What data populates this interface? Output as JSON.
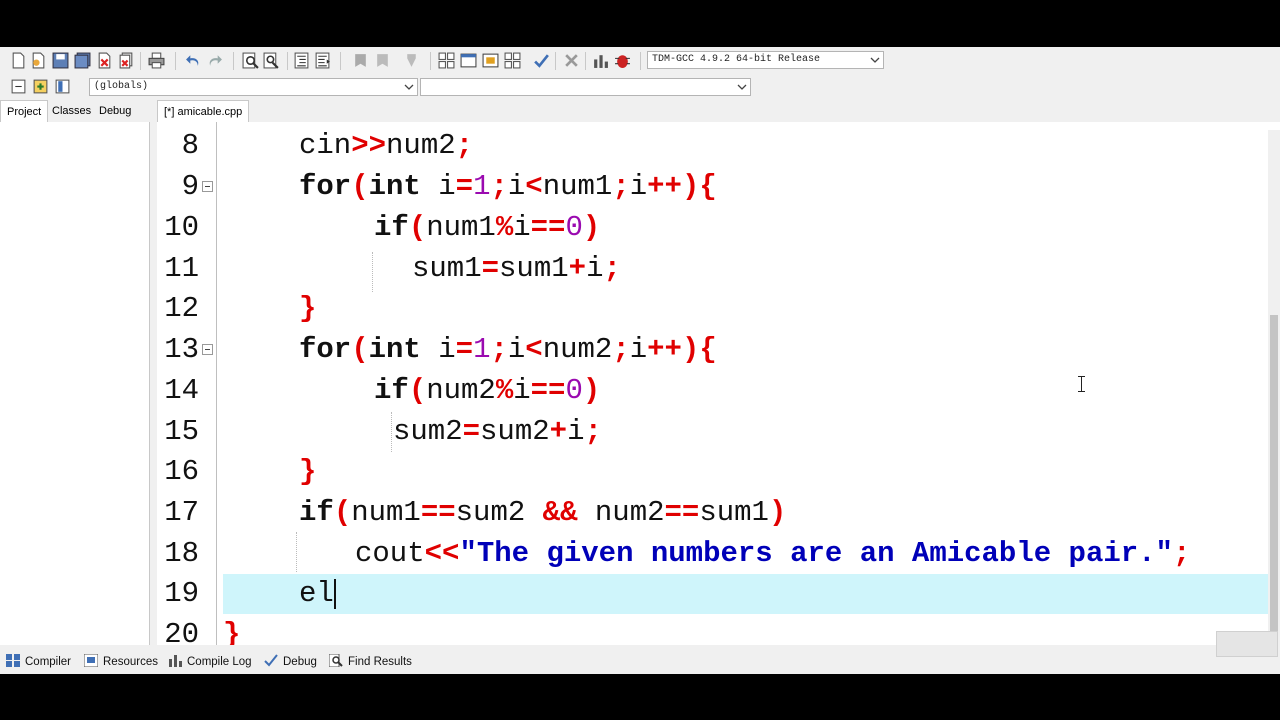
{
  "toolbar": {
    "compiler_select": "TDM-GCC 4.9.2 64-bit Release",
    "scope_select": "(globals)",
    "member_select": ""
  },
  "side_tabs": [
    "Project",
    "Classes",
    "Debug"
  ],
  "editor_tab": "[*] amicable.cpp",
  "editor": {
    "highlight_color": "#cff5fb",
    "lines": [
      {
        "n": "8"
      },
      {
        "n": "9"
      },
      {
        "n": "10"
      },
      {
        "n": "11"
      },
      {
        "n": "12"
      },
      {
        "n": "13"
      },
      {
        "n": "14"
      },
      {
        "n": "15"
      },
      {
        "n": "16"
      },
      {
        "n": "17"
      },
      {
        "n": "18"
      },
      {
        "n": "19"
      },
      {
        "n": "20"
      }
    ],
    "code": {
      "l8": [
        "cin",
        ">>",
        "num2",
        ";"
      ],
      "l9": [
        "for",
        "(",
        "int",
        " i",
        "=",
        "1",
        ";",
        "i",
        "<",
        "num1",
        ";",
        "i",
        "++",
        "){"
      ],
      "l10": [
        "if",
        "(",
        "num1",
        "%",
        "i",
        "==",
        "0",
        ")"
      ],
      "l11": [
        "sum1",
        "=",
        "sum1",
        "+",
        "i",
        ";"
      ],
      "l12": [
        "}"
      ],
      "l13": [
        "for",
        "(",
        "int",
        " i",
        "=",
        "1",
        ";",
        "i",
        "<",
        "num2",
        ";",
        "i",
        "++",
        "){"
      ],
      "l14": [
        "if",
        "(",
        "num2",
        "%",
        "i",
        "==",
        "0",
        ")"
      ],
      "l15": [
        "sum2",
        "=",
        "sum2",
        "+",
        "i",
        ";"
      ],
      "l16": [
        "}"
      ],
      "l17": [
        "if",
        "(",
        "num1",
        "==",
        "sum2 ",
        "&&",
        " num2",
        "==",
        "sum1",
        ")"
      ],
      "l18": [
        "cout",
        "<<",
        "\"The given numbers are an Amicable pair.\"",
        ";"
      ],
      "l19": [
        "el"
      ],
      "l20": [
        "}"
      ]
    }
  },
  "bottom_tabs": [
    "Compiler",
    "Resources",
    "Compile Log",
    "Debug",
    "Find Results"
  ],
  "icons": [
    "new-file-icon",
    "open-icon",
    "save-icon",
    "save-all-icon",
    "close-icon",
    "close-all-icon",
    "print-icon",
    "undo-icon",
    "redo-icon",
    "find-icon",
    "replace-icon",
    "indent-icon",
    "unindent-icon",
    "bookmark-icon",
    "goto-icon",
    "new-class-icon",
    "compile-icon",
    "run-icon",
    "compile-run-icon",
    "rebuild-icon",
    "check-syntax-icon",
    "stop-icon",
    "profile-icon",
    "debug-icon"
  ]
}
